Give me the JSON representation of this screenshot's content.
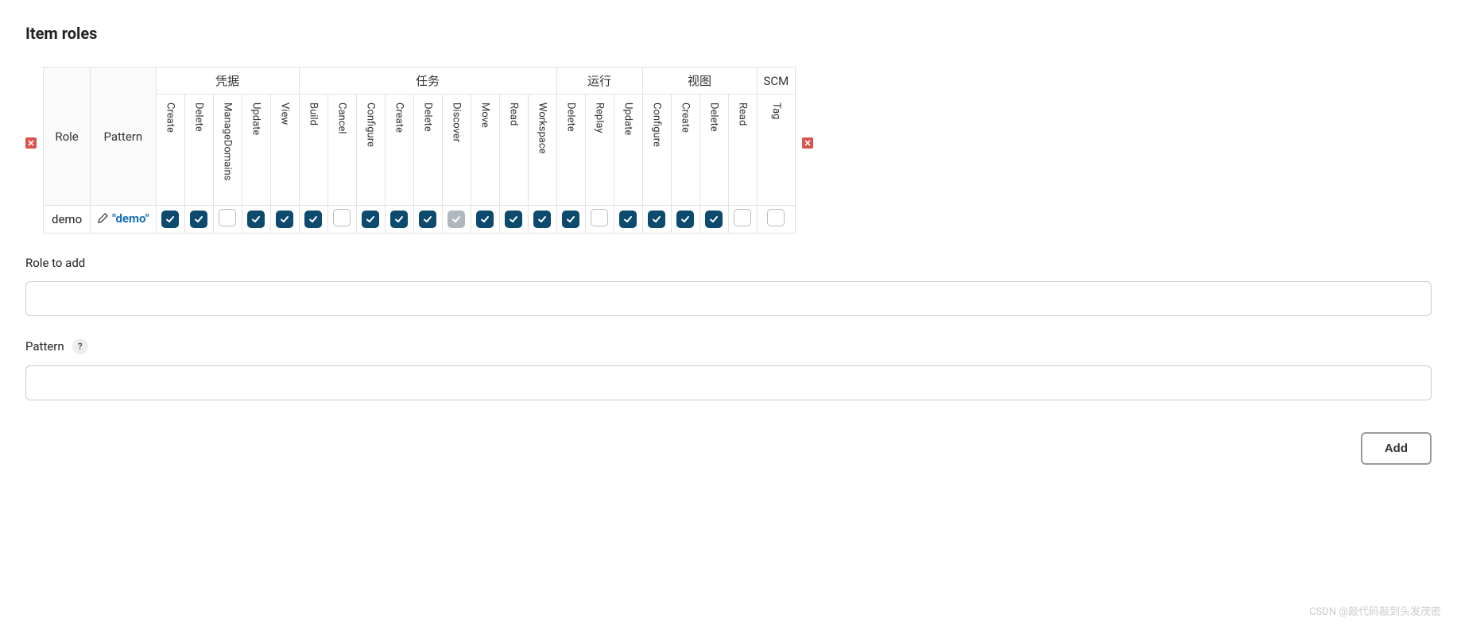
{
  "section_title": "Item roles",
  "headers": {
    "role": "Role",
    "pattern": "Pattern"
  },
  "groups": [
    {
      "label": "凭据",
      "perms": [
        "Create",
        "Delete",
        "ManageDomains",
        "Update",
        "View"
      ]
    },
    {
      "label": "任务",
      "perms": [
        "Build",
        "Cancel",
        "Configure",
        "Create",
        "Delete",
        "Discover",
        "Move",
        "Read",
        "Workspace"
      ]
    },
    {
      "label": "运行",
      "perms": [
        "Delete",
        "Replay",
        "Update"
      ]
    },
    {
      "label": "视图",
      "perms": [
        "Configure",
        "Create",
        "Delete",
        "Read"
      ]
    },
    {
      "label": "SCM",
      "perms": [
        "Tag"
      ]
    }
  ],
  "rows": [
    {
      "role": "demo",
      "pattern": "\"demo\"",
      "checks": [
        "checked",
        "checked",
        "unchecked",
        "checked",
        "checked",
        "checked",
        "unchecked",
        "checked",
        "checked",
        "checked",
        "muted",
        "checked",
        "checked",
        "checked",
        "checked",
        "unchecked",
        "checked",
        "checked",
        "checked",
        "checked",
        "unchecked",
        "unchecked"
      ]
    }
  ],
  "form": {
    "role_label": "Role to add",
    "pattern_label": "Pattern",
    "help": "?",
    "add_button": "Add",
    "role_value": "",
    "pattern_value": ""
  },
  "watermark": "CSDN @敲代码敲到头发茂密"
}
